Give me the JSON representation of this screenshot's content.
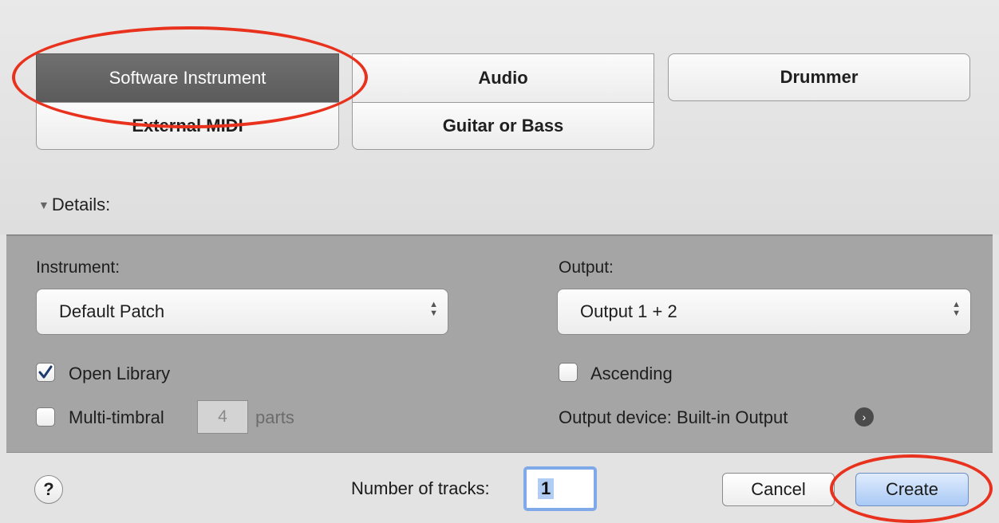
{
  "track_types": {
    "software_instrument": "Software Instrument",
    "audio": "Audio",
    "drummer": "Drummer",
    "external_midi": "External MIDI",
    "guitar_or_bass": "Guitar or Bass",
    "selected": "Software Instrument"
  },
  "details": {
    "toggle_label": "Details:",
    "instrument_label": "Instrument:",
    "instrument_value": "Default Patch",
    "output_label": "Output:",
    "output_value": "Output 1 + 2",
    "open_library_label": "Open Library",
    "open_library_checked": true,
    "multitimbral_label": "Multi-timbral",
    "multitimbral_checked": false,
    "parts_value": "4",
    "parts_label": "parts",
    "ascending_label": "Ascending",
    "ascending_checked": false,
    "output_device_label": "Output device: Built-in Output"
  },
  "footer": {
    "help_label": "?",
    "tracks_label": "Number of tracks:",
    "tracks_value": "1",
    "cancel_label": "Cancel",
    "create_label": "Create"
  },
  "colors": {
    "selected_button": "#636363",
    "details_background": "#a5a5a5",
    "primary_button": "#a9c9f5",
    "annotation": "#e8321e"
  }
}
